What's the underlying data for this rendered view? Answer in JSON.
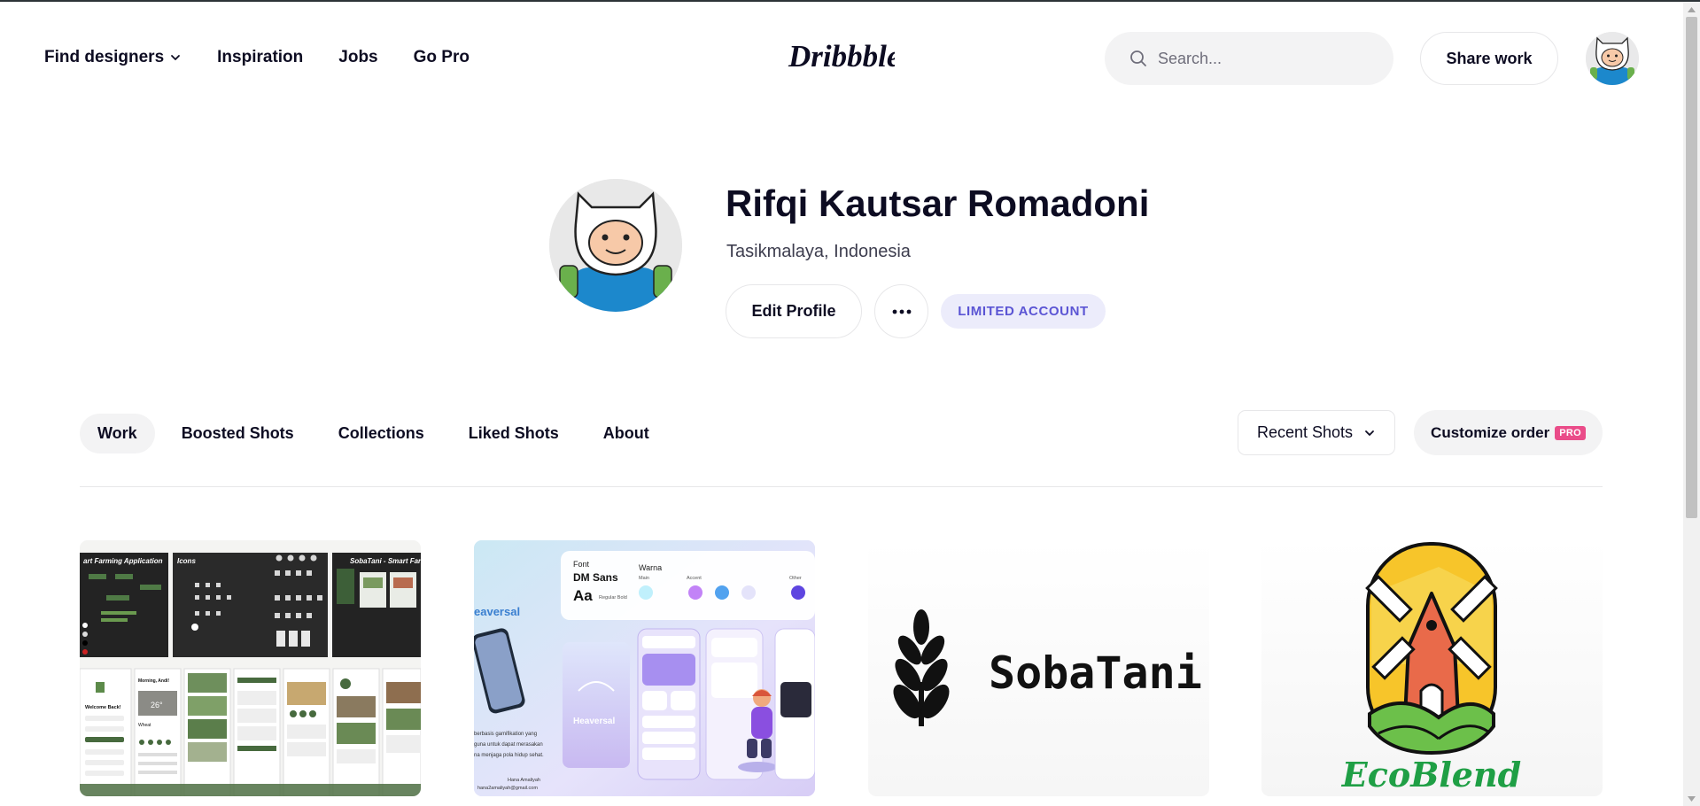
{
  "header": {
    "nav": [
      {
        "label": "Find designers",
        "has_dropdown": true
      },
      {
        "label": "Inspiration",
        "has_dropdown": false
      },
      {
        "label": "Jobs",
        "has_dropdown": false
      },
      {
        "label": "Go Pro",
        "has_dropdown": false
      }
    ],
    "logo_text": "Dribbble",
    "search_placeholder": "Search...",
    "share_label": "Share work",
    "avatar_icon": "finn-avatar-icon"
  },
  "profile": {
    "name": "Rifqi Kautsar Romadoni",
    "location": "Tasikmalaya, Indonesia",
    "edit_label": "Edit Profile",
    "more_icon": "more-dots-icon",
    "badge": "LIMITED ACCOUNT"
  },
  "tabs": [
    {
      "label": "Work",
      "active": true
    },
    {
      "label": "Boosted Shots",
      "active": false
    },
    {
      "label": "Collections",
      "active": false
    },
    {
      "label": "Liked Shots",
      "active": false
    },
    {
      "label": "About",
      "active": false
    }
  ],
  "sort": {
    "label": "Recent Shots"
  },
  "customize": {
    "label": "Customize order",
    "badge": "PRO"
  },
  "shots": [
    {
      "title": "SobaTani - Smart Farming App",
      "labels": {
        "board1": "art Farming Application",
        "board2": "Icons",
        "board3": "SobaTani - Smart Farm",
        "welcome": "Welcome Back!",
        "greeting": "Morning, Andi!",
        "temp": "26°",
        "crop": "Wheat"
      }
    },
    {
      "title": "Heaversal",
      "labels": {
        "font_label": "Font",
        "font_name": "DM Sans",
        "aa": "Aa",
        "weights": "Regular Bold",
        "warna": "Warna",
        "main": "Main",
        "accent": "Accent",
        "other": "Other",
        "brand": "eaversal",
        "brand2": "Heaversal",
        "desc1": "berbasis gamifikation yang",
        "desc2": "guna untuk dapat merasakan",
        "desc3": "na menjaga pola hidup sehat.",
        "author": "Hana Amaliyah",
        "email": "hana2amaliyah@gmail.com"
      },
      "colors": {
        "main": "#C0F0FC",
        "accent1": "#C283F7",
        "accent2": "#52A2EF",
        "accent3": "#E4E3FA",
        "other": "#5E45E0"
      }
    },
    {
      "title": "SobaTani",
      "logo_text": "SobaTani"
    },
    {
      "title": "EcoBlend",
      "logo_text": "EcoBlend"
    }
  ],
  "colors": {
    "brand_pink": "#EA4C89",
    "text": "#0D0C22",
    "badge_bg": "#ECECFB",
    "badge_text": "#5B55D4",
    "ecoblend_green": "#1F9F45"
  }
}
